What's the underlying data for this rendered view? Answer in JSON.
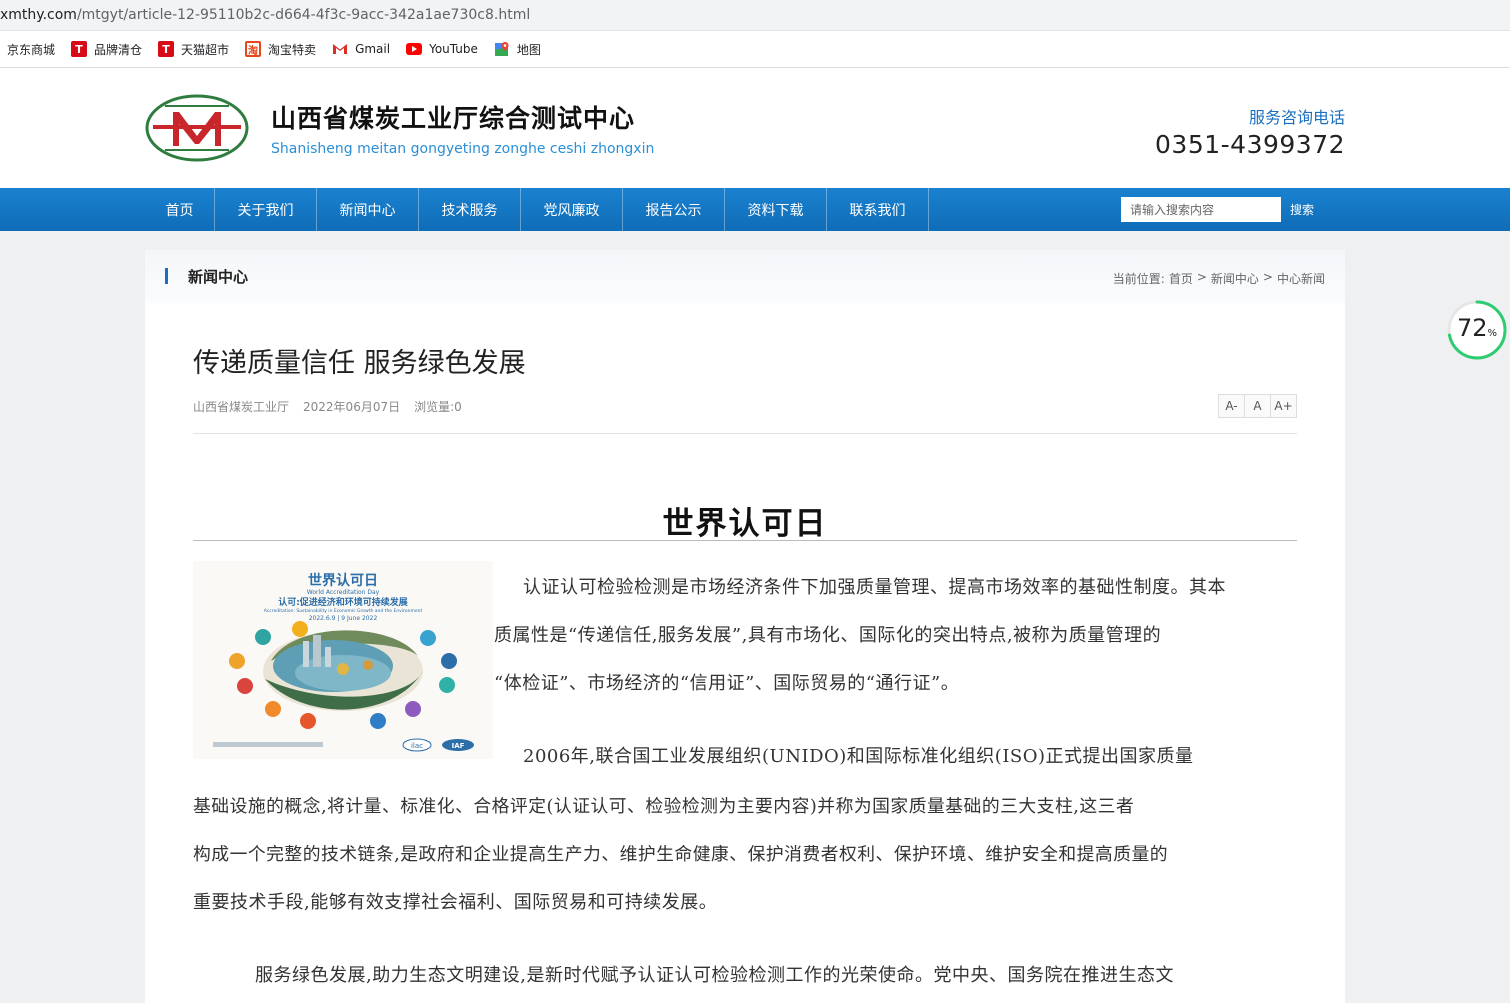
{
  "browser": {
    "url_host": "xmthy.com",
    "url_path": "/mtgyt/article-12-95110b2c-d664-4f3c-9acc-342a1ae730c8.html",
    "bookmarks": [
      {
        "label": "京东商城",
        "icon": "jd-icon"
      },
      {
        "label": "品牌清仓",
        "icon": "tmall-icon"
      },
      {
        "label": "天猫超市",
        "icon": "tmall-icon"
      },
      {
        "label": "淘宝特卖",
        "icon": "taobao-icon"
      },
      {
        "label": "Gmail",
        "icon": "gmail-icon"
      },
      {
        "label": "YouTube",
        "icon": "youtube-icon"
      },
      {
        "label": "地图",
        "icon": "maps-icon"
      }
    ]
  },
  "header": {
    "title_cn": "山西省煤炭工业厅综合测试中心",
    "title_pinyin": "Shanisheng meitan gongyeting zonghe ceshi zhongxin",
    "hotline_label": "服务咨询电话",
    "hotline_number": "0351-4399372"
  },
  "nav": {
    "items": [
      "首页",
      "关于我们",
      "新闻中心",
      "技术服务",
      "党风廉政",
      "报告公示",
      "资料下载",
      "联系我们"
    ],
    "search_placeholder": "请输入搜索内容",
    "search_button": "搜索"
  },
  "section": {
    "title": "新闻中心",
    "crumb_prefix": "当前位置:",
    "crumbs": [
      "首页",
      "新闻中心",
      "中心新闻"
    ]
  },
  "article": {
    "title": "传递质量信任 服务绿色发展",
    "source": "山西省煤炭工业厅",
    "date": "2022年06月07日",
    "views_label": "浏览量:",
    "views": "0",
    "font_buttons": [
      "A-",
      "A",
      "A+"
    ],
    "heading": "世界认可日",
    "poster": {
      "title": "世界认可日",
      "subtitle_en": "World Accreditation Day",
      "theme": "认可:促进经济和环境可持续发展",
      "theme_en": "Accreditation: Sustainability in Economic Growth and the Environment",
      "date": "2022.6.9 | 9 June 2022",
      "logo_left": "ilac",
      "logo_right": "IAF"
    },
    "lines": [
      "认证认可检验检测是市场经济条件下加强质量管理、提高市场效率的基础性制度。其本",
      "质属性是“传递信任,服务发展”,具有市场化、国际化的突出特点,被称为质量管理的",
      "“体检证”、市场经济的“信用证”、国际贸易的“通行证”。",
      "2006年,联合国工业发展组织(UNIDO)和国际标准化组织(ISO)正式提出国家质量",
      "基础设施的概念,将计量、标准化、合格评定(认证认可、检验检测为主要内容)并称为国家质量基础的三大支柱,这三者",
      "构成一个完整的技术链条,是政府和企业提高生产力、维护生命健康、保护消费者权利、保护环境、维护安全和提高质量的",
      "重要技术手段,能够有效支撑社会福利、国际贸易和可持续发展。",
      "服务绿色发展,助力生态文明建设,是新时代赋予认证认可检验检测工作的光荣使命。党中央、国务院在推进生态文"
    ]
  },
  "widget": {
    "value": "72",
    "unit": "%",
    "progress": 0.72,
    "color": "#2ecc71"
  }
}
